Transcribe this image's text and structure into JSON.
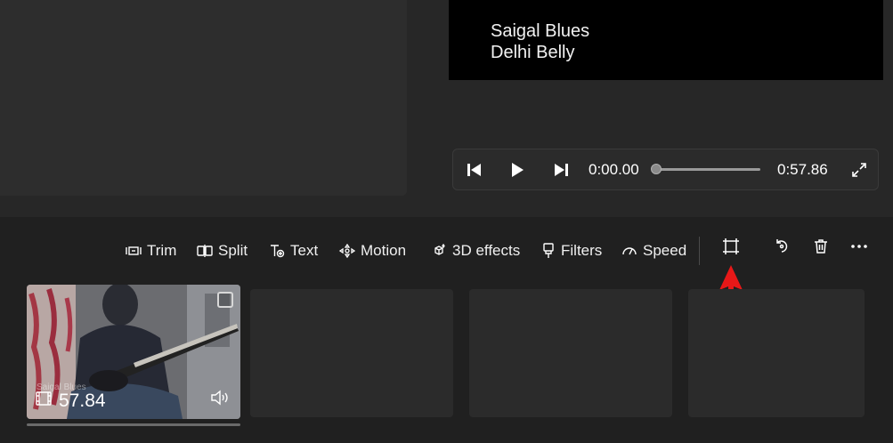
{
  "preview": {
    "lines": [
      "Saigal Blues",
      "Delhi Belly"
    ]
  },
  "player": {
    "current_time": "0:00.00",
    "total_time": "0:57.86",
    "progress": 0.0
  },
  "toolbar": {
    "trim_label": "Trim",
    "split_label": "Split",
    "text_label": "Text",
    "motion_label": "Motion",
    "effects_label": "3D effects",
    "filters_label": "Filters",
    "speed_label": "Speed",
    "icons": [
      "trim-icon",
      "split-icon",
      "text-icon",
      "motion-icon",
      "3d-effects-icon",
      "filters-icon",
      "speed-icon",
      "crop-icon",
      "rotate-icon",
      "delete-icon",
      "more-icon"
    ]
  },
  "timeline": {
    "clip": {
      "duration": "57.84",
      "overlay_text": "Saigal Blues"
    },
    "empty_slots": 3
  },
  "colors": {
    "background": "#202020",
    "panel": "#2d2d2d",
    "annotation_arrow": "#e81818"
  }
}
